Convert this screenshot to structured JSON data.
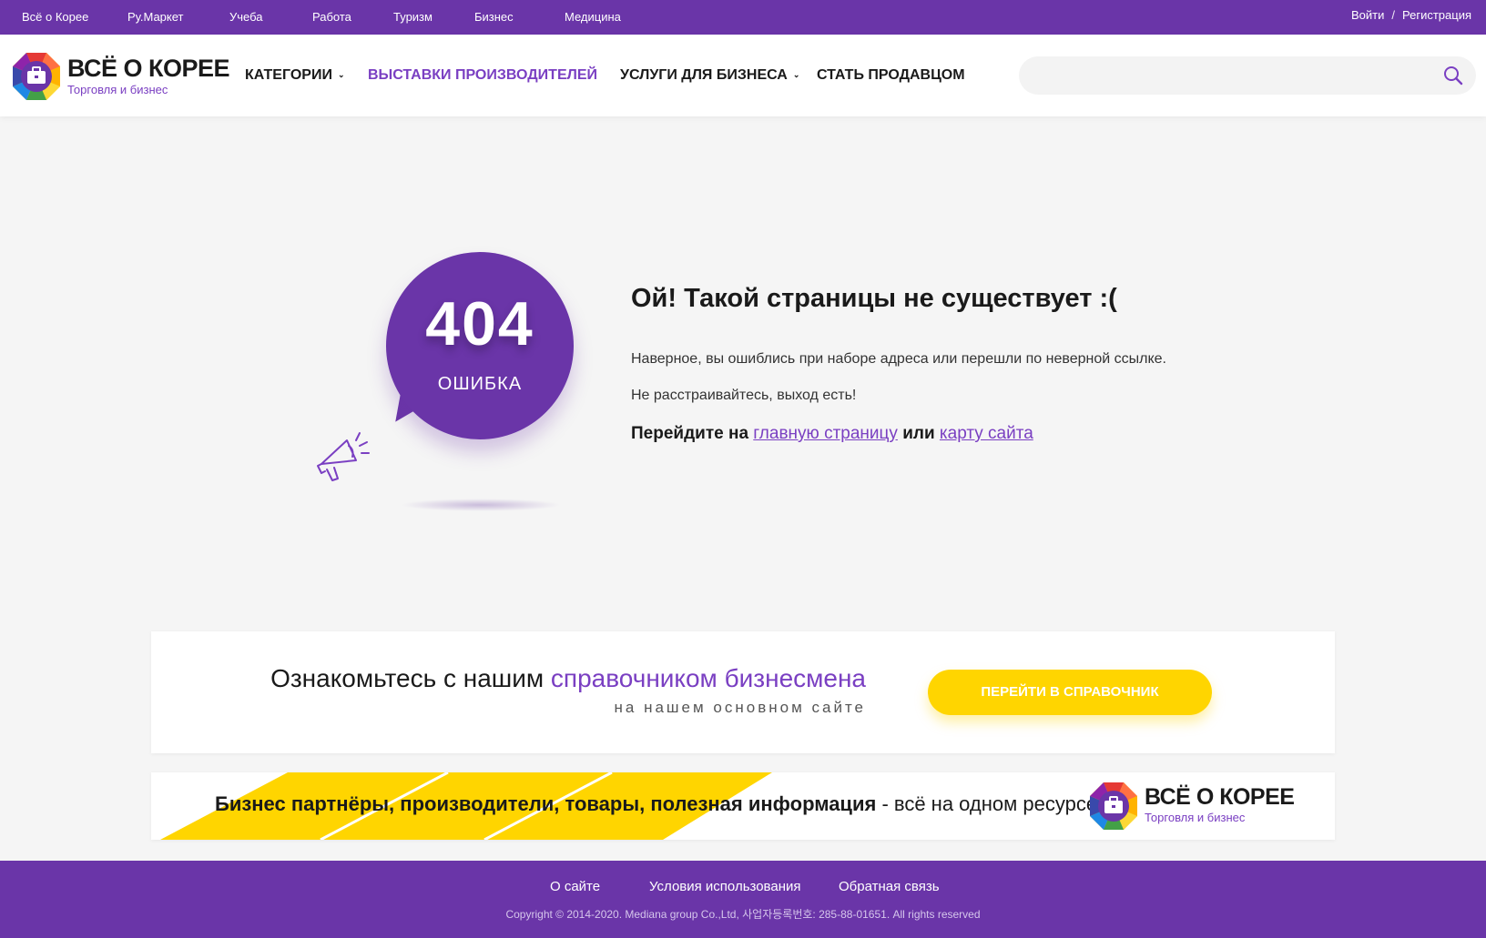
{
  "topbar": {
    "links": [
      "Всё о Корее",
      "Ру.Маркет",
      "Учеба",
      "Работа",
      "Туризм",
      "Бизнес",
      "Медицина"
    ],
    "login": "Войти",
    "separator": "/",
    "register": "Регистрация"
  },
  "header": {
    "logo_name": "ВСЁ О КОРЕЕ",
    "logo_sub": "Торговля и бизнес",
    "nav": {
      "categories": "КАТЕГОРИИ",
      "exhibitions": "ВЫСТАВКИ ПРОИЗВОДИТЕЛЕЙ",
      "services": "УСЛУГИ ДЛЯ БИЗНЕСА",
      "become_seller": "СТАТЬ ПРОДАВЦОМ"
    },
    "search_placeholder": "",
    "search_icon": "search-icon"
  },
  "error": {
    "code": "404",
    "label": "ОШИБКА",
    "title": "Ой!  Такой страницы не существует :(",
    "line1": "Наверное, вы ошиблись при наборе адреса или перешли по неверной ссылке.",
    "line2": "Не расстраивайтесь, выход есть!",
    "go_prefix": "Перейдите на",
    "link_home": "главную страницу",
    "go_or": "или",
    "link_sitemap": "карту сайта"
  },
  "promo": {
    "text_prefix": "Ознакомьтесь с нашим",
    "text_accent": "справочником бизнесмена",
    "subtext": "на нашем основном сайте",
    "button": "ПЕРЕЙТИ В СПРАВОЧНИК"
  },
  "strip": {
    "bold_text": "Бизнес партнёры, производители, товары, полезная информация",
    "rest_text": "- всё на одном ресурсе",
    "logo_name": "ВСЁ О КОРЕЕ",
    "logo_sub": "Торговля и бизнес"
  },
  "footer": {
    "links": [
      "О сайте",
      "Условия использования",
      "Обратная связь"
    ],
    "copyright": "Copyright © 2014-2020. Mediana group Co.,Ltd, 사업자등록번호: 285-88-01651. All rights reserved"
  },
  "colors": {
    "brand_purple": "#6a35a8",
    "accent_purple": "#7a3fc2",
    "yellow": "#ffd500"
  }
}
